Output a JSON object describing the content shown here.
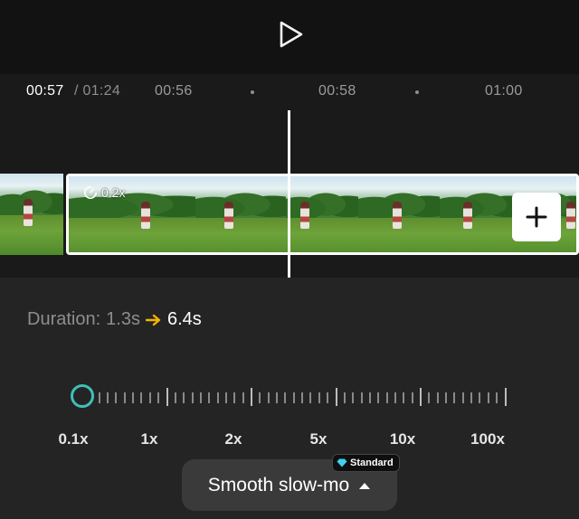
{
  "timeline": {
    "current_time": "00:57",
    "total_time": "/ 01:24",
    "ticks": [
      "00:56",
      "00:58",
      "01:00"
    ]
  },
  "clip": {
    "speed_badge": "0.2x"
  },
  "panel": {
    "duration_label": "Duration:",
    "duration_from": "1.3s",
    "duration_to": "6.4s",
    "speed_labels": [
      "0.1x",
      "1x",
      "2x",
      "5x",
      "10x",
      "100x"
    ],
    "speed_value": "0.2x",
    "smooth_label": "Smooth slow-mo",
    "standard_badge": "Standard"
  },
  "icons": [
    "play-icon",
    "speed-icon",
    "plus-icon",
    "arrow-right-icon",
    "diamond-icon",
    "caret-up-icon"
  ],
  "colors": {
    "accent": "#3fc0b8",
    "arrow": "#f5b400"
  }
}
